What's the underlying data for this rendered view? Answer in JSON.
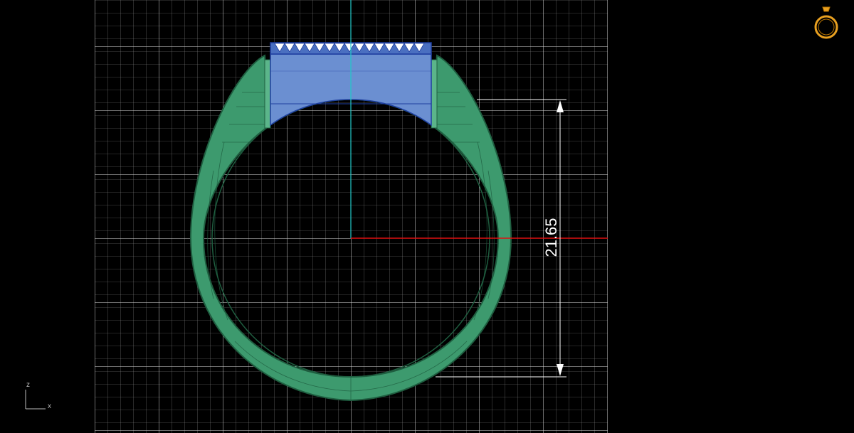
{
  "viewport": {
    "background": "#000000",
    "grid_color": "#8a8a8a",
    "grid_major_color": "#d8d8d8",
    "band_color": "#3d9a6e",
    "band_line_color": "#1f5e40",
    "head_color": "#6b8fd1",
    "head_line_color": "#1f3fa0",
    "axis_vertical_color": "#22c8c8",
    "axis_horizontal_color": "#e01010"
  },
  "dimension": {
    "value": "21.65"
  },
  "axes": {
    "z_label": "z",
    "x_label": "x"
  },
  "icons": {
    "view_icon": "ring-icon"
  }
}
